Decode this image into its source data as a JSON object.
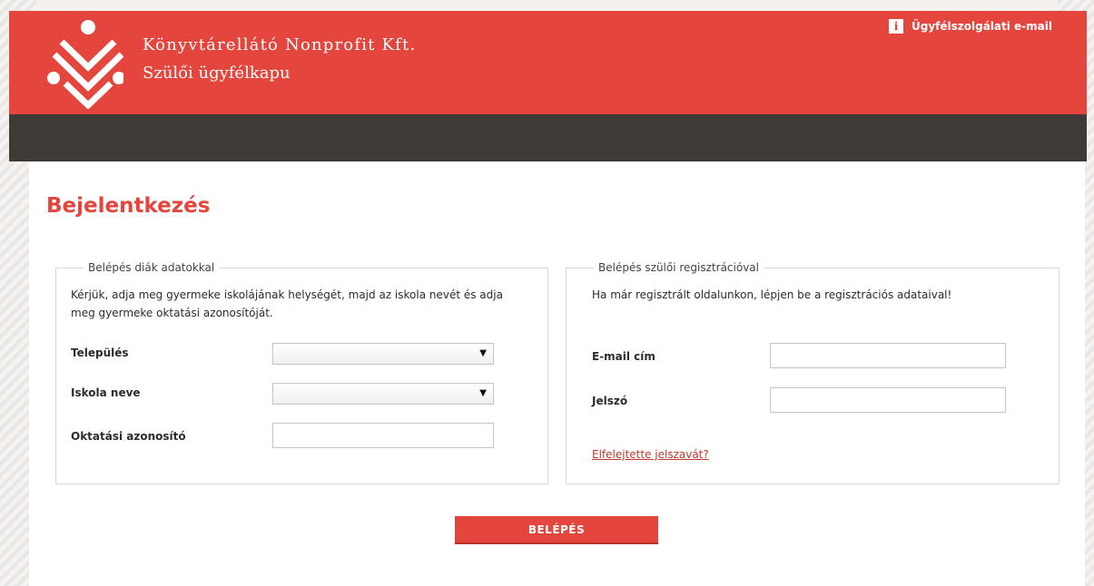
{
  "header": {
    "brand_name": "Könyvtárellátó Nonprofit Kft.",
    "brand_subtitle": "Szülői ügyfélkapu",
    "support_icon": "info-icon",
    "support_icon_glyph": "i",
    "support_label": "Ügyfélszolgálati e-mail"
  },
  "colors": {
    "accent": "#e4453c",
    "navbar": "#403a36",
    "link": "#c0392b"
  },
  "page": {
    "title": "Bejelentkezés"
  },
  "student_login": {
    "legend": "Belépés diák adatokkal",
    "intro": "Kérjük, adja meg gyermeke iskolájának helységét, majd az iskola nevét és adja meg gyermeke oktatási azonosítóját.",
    "settlement_label": "Település",
    "settlement_value": "",
    "school_label": "Iskola neve",
    "school_value": "",
    "id_label": "Oktatási azonosító",
    "id_value": "",
    "dropdown_arrow": "▼"
  },
  "parent_login": {
    "legend": "Belépés szülői regisztrációval",
    "intro": "Ha már regisztrált oldalunkon, lépjen be a regisztrációs adataival!",
    "email_label": "E-mail cím",
    "email_value": "",
    "password_label": "Jelszó",
    "password_value": "",
    "forgot_link": "Elfelejtette jelszavát?"
  },
  "actions": {
    "login_label": "BELÉPÉS"
  }
}
